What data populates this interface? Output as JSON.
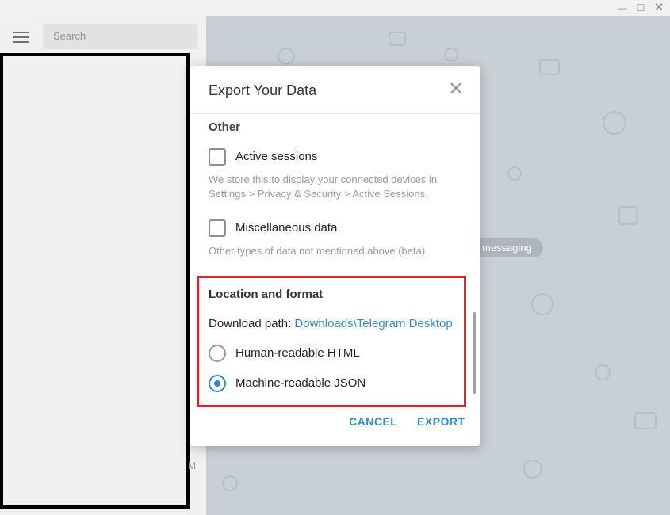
{
  "window": {
    "min_glyph": "—",
    "max_glyph": "☐",
    "close_glyph": "✕"
  },
  "sidebar": {
    "search_placeholder": "Search",
    "peek_letter": "M"
  },
  "chat": {
    "service_pill": "messaging"
  },
  "dialog": {
    "title": "Export Your Data",
    "close_glyph": "✕",
    "other_section": {
      "title": "Other",
      "items": [
        {
          "label": "Active sessions",
          "checked": false,
          "description": "We store this to display your connected devices in Settings > Privacy & Security > Active Sessions."
        },
        {
          "label": "Miscellaneous data",
          "checked": false,
          "description": "Other types of data not mentioned above (beta)."
        }
      ]
    },
    "location_section": {
      "title": "Location and format",
      "download_path_label": "Download path:",
      "download_path_value": "Downloads\\Telegram Desktop",
      "format_options": [
        {
          "label": "Human-readable HTML",
          "selected": false
        },
        {
          "label": "Machine-readable JSON",
          "selected": true
        }
      ]
    },
    "buttons": {
      "cancel": "CANCEL",
      "export": "EXPORT"
    }
  },
  "colors": {
    "accent": "#2f8ad0",
    "highlight_border": "#e0202a",
    "chat_background": "#c8cfd6"
  }
}
